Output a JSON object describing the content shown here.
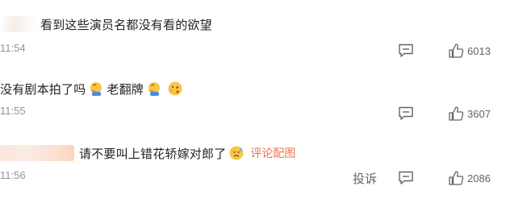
{
  "comments": [
    {
      "text": "看到这些演员名都没有看的欲望",
      "time": "11:54",
      "likes": "6013"
    },
    {
      "text_part1": "没有剧本拍了吗",
      "text_part2": "老翻牌",
      "time": "11:55",
      "likes": "3607",
      "emojis": [
        "facepalm-emoji",
        "facepalm-emoji",
        "kissing-emoji"
      ]
    },
    {
      "text": "请不要叫上错花轿嫁对郎了",
      "link": "评论配图",
      "time": "11:56",
      "likes": "2086",
      "report": "投诉",
      "emojis": [
        "sweat-emoji"
      ]
    }
  ],
  "colors": {
    "text": "#222222",
    "meta": "#939393",
    "link": "#eb7350",
    "icon": "#636363"
  }
}
